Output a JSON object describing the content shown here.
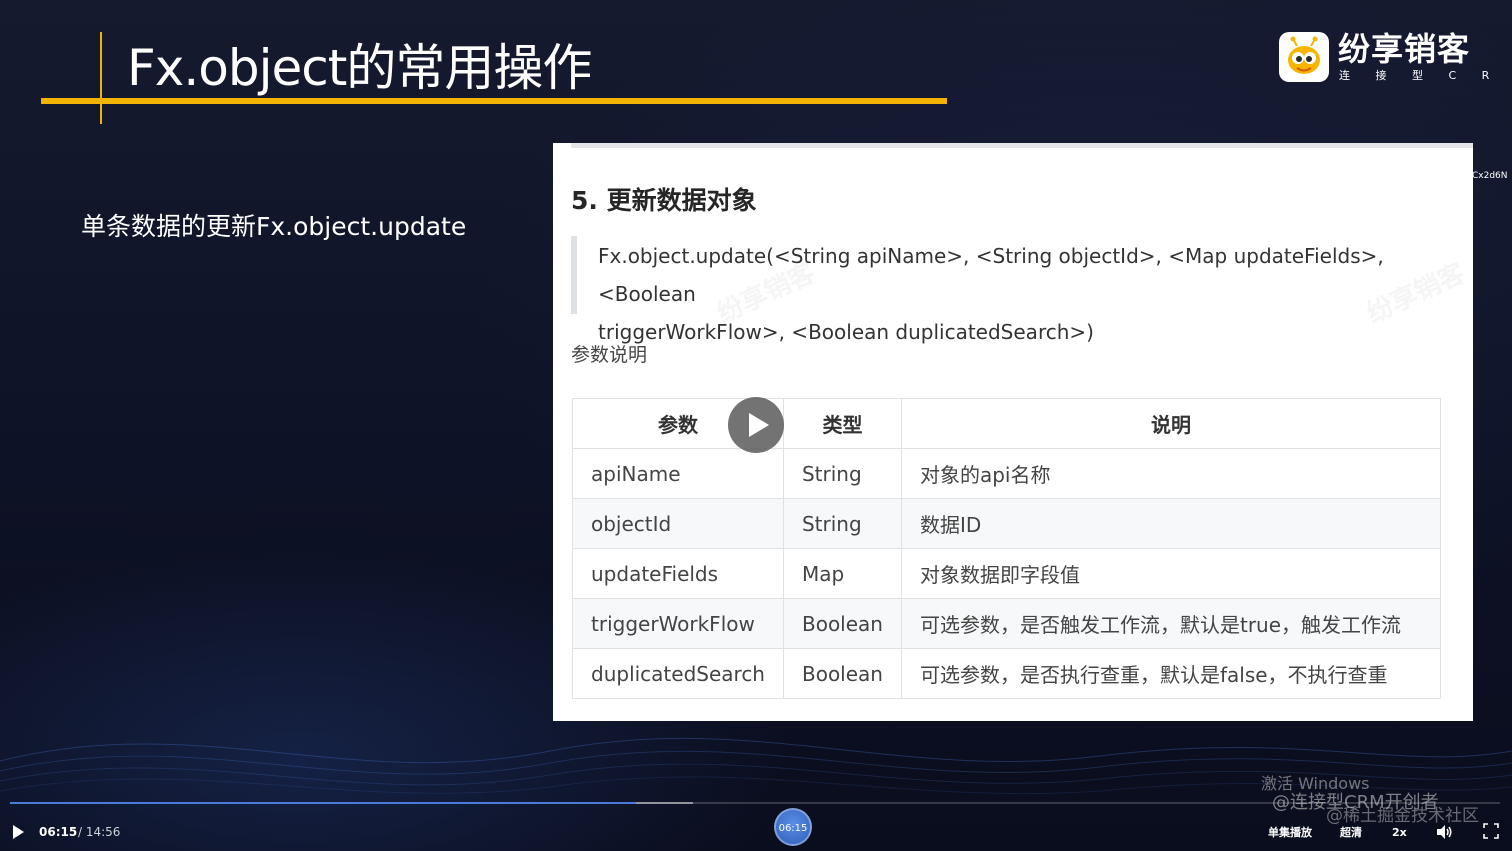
{
  "slide": {
    "title": "Fx.object的常用操作",
    "subtitle": "单条数据的更新Fx.object.update"
  },
  "logo": {
    "name": "纷享销客",
    "tagline": "连 接 型 C R M",
    "icon": "bee-mascot-icon"
  },
  "side_tag": "Cx2d6N",
  "doc": {
    "heading": "5. 更新数据对象",
    "code_line1": "Fx.object.update(<String apiName>, <String objectId>, <Map updateFields>, <Boolean",
    "code_line2": "triggerWorkFlow>, <Boolean duplicatedSearch>)",
    "params_label": "参数说明",
    "table": {
      "headers": [
        "参数",
        "类型",
        "说明"
      ],
      "rows": [
        [
          "apiName",
          "String",
          "对象的api名称"
        ],
        [
          "objectId",
          "String",
          "数据ID"
        ],
        [
          "updateFields",
          "Map",
          "对象数据即字段值"
        ],
        [
          "triggerWorkFlow",
          "Boolean",
          "可选参数，是否触发工作流，默认是true，触发工作流"
        ],
        [
          "duplicatedSearch",
          "Boolean",
          "可选参数，是否执行查重，默认是false，不执行查重"
        ]
      ]
    },
    "watermark": "纷享销客"
  },
  "overlays": {
    "activate_windows": "激活 Windows",
    "uploader": "@连接型CRM开创者",
    "platform": "@稀土掘金技术社区"
  },
  "player": {
    "current_time": "06:15",
    "total_time": "/ 14:56",
    "thumb_time": "06:15",
    "progress": 0.42,
    "single_play_label": "单集播放",
    "quality_label": "超清",
    "speed_label": "2x",
    "icons": [
      "play-icon",
      "volume-icon",
      "fullscreen-icon"
    ],
    "accent_color": "#4a7bd8"
  },
  "colors": {
    "title_accent": "#f2b400",
    "background": "#0e1226"
  }
}
